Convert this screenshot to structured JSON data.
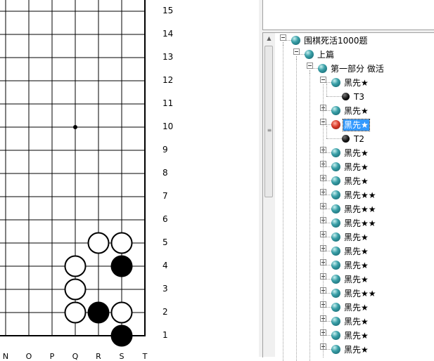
{
  "board": {
    "row_labels": [
      "15",
      "14",
      "13",
      "12",
      "11",
      "10",
      "9",
      "8",
      "7",
      "6",
      "5",
      "4",
      "3",
      "2",
      "1"
    ],
    "col_labels": [
      "N",
      "O",
      "P",
      "Q",
      "R",
      "S",
      "T"
    ],
    "black_stones": [
      [
        "S",
        4
      ],
      [
        "R",
        2
      ],
      [
        "S",
        1
      ]
    ],
    "white_stones": [
      [
        "R",
        5
      ],
      [
        "S",
        5
      ],
      [
        "Q",
        4
      ],
      [
        "Q",
        3
      ],
      [
        "Q",
        2
      ],
      [
        "S",
        2
      ]
    ],
    "star_points": [
      [
        "Q",
        10
      ]
    ]
  },
  "tree": {
    "root": {
      "label": "围棋死活1000题",
      "icon": "teal-ball"
    },
    "section": {
      "label": "上篇",
      "icon": "teal-ball"
    },
    "part": {
      "label": "第一部分  做活",
      "icon": "teal-ball"
    },
    "problems": [
      {
        "label": "黑先★",
        "expanded": true,
        "child": "T3"
      },
      {
        "label": "黑先★",
        "expanded": false
      },
      {
        "label": "黑先★",
        "expanded": true,
        "selected": true,
        "icon": "red-ball",
        "child": "T2"
      },
      {
        "label": "黑先★"
      },
      {
        "label": "黑先★"
      },
      {
        "label": "黑先★"
      },
      {
        "label": "黑先★★"
      },
      {
        "label": "黑先★★"
      },
      {
        "label": "黑先★★"
      },
      {
        "label": "黑先★"
      },
      {
        "label": "黑先★"
      },
      {
        "label": "黑先★"
      },
      {
        "label": "黑先★"
      },
      {
        "label": "黑先★★"
      },
      {
        "label": "黑先★"
      },
      {
        "label": "黑先★"
      },
      {
        "label": "黑先★"
      },
      {
        "label": "黑先★"
      }
    ]
  },
  "colors": {
    "selection": "#3399ff",
    "board_bg": "#ffffff",
    "grid": "#000000"
  }
}
